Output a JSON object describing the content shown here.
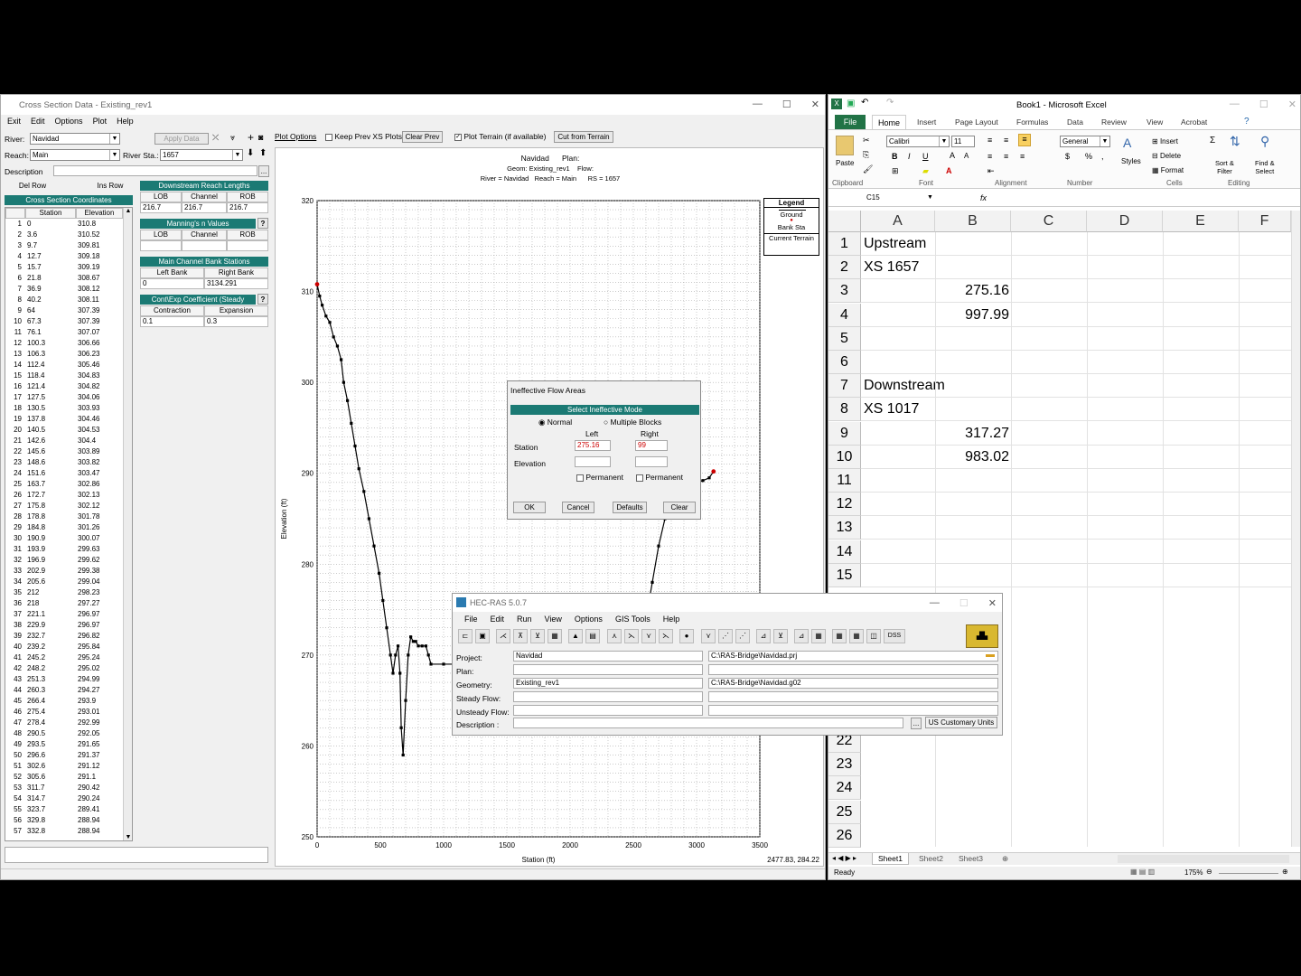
{
  "xs_window": {
    "title": "Cross Section Data - Existing_rev1",
    "menu": [
      "Exit",
      "Edit",
      "Options",
      "Plot",
      "Help"
    ],
    "river_label": "River:",
    "river_value": "Navidad",
    "reach_label": "Reach:",
    "reach_value": "Main",
    "river_sta_label": "River Sta.:",
    "river_sta_value": "1657",
    "apply_data": "Apply Data",
    "description_label": "Description",
    "del_row": "Del Row",
    "ins_row": "Ins Row",
    "plot_options": "Plot Options",
    "keep_prev": "Keep Prev XS Plots",
    "clear_prev": "Clear Prev",
    "plot_terrain": "Plot Terrain (if available)",
    "cut_terrain": "Cut from Terrain",
    "coords_title": "Cross Section Coordinates",
    "station_hdr": "Station",
    "elevation_hdr": "Elevation",
    "coords": [
      [
        "1",
        "0",
        "310.8"
      ],
      [
        "2",
        "3.6",
        "310.52"
      ],
      [
        "3",
        "9.7",
        "309.81"
      ],
      [
        "4",
        "12.7",
        "309.18"
      ],
      [
        "5",
        "15.7",
        "309.19"
      ],
      [
        "6",
        "21.8",
        "308.67"
      ],
      [
        "7",
        "36.9",
        "308.12"
      ],
      [
        "8",
        "40.2",
        "308.11"
      ],
      [
        "9",
        "64",
        "307.39"
      ],
      [
        "10",
        "67.3",
        "307.39"
      ],
      [
        "11",
        "76.1",
        "307.07"
      ],
      [
        "12",
        "100.3",
        "306.66"
      ],
      [
        "13",
        "106.3",
        "306.23"
      ],
      [
        "14",
        "112.4",
        "305.46"
      ],
      [
        "15",
        "118.4",
        "304.83"
      ],
      [
        "16",
        "121.4",
        "304.82"
      ],
      [
        "17",
        "127.5",
        "304.06"
      ],
      [
        "18",
        "130.5",
        "303.93"
      ],
      [
        "19",
        "137.8",
        "304.46"
      ],
      [
        "20",
        "140.5",
        "304.53"
      ],
      [
        "21",
        "142.6",
        "304.4"
      ],
      [
        "22",
        "145.6",
        "303.89"
      ],
      [
        "23",
        "148.6",
        "303.82"
      ],
      [
        "24",
        "151.6",
        "303.47"
      ],
      [
        "25",
        "163.7",
        "302.86"
      ],
      [
        "26",
        "172.7",
        "302.13"
      ],
      [
        "27",
        "175.8",
        "302.12"
      ],
      [
        "28",
        "178.8",
        "301.78"
      ],
      [
        "29",
        "184.8",
        "301.26"
      ],
      [
        "30",
        "190.9",
        "300.07"
      ],
      [
        "31",
        "193.9",
        "299.63"
      ],
      [
        "32",
        "196.9",
        "299.62"
      ],
      [
        "33",
        "202.9",
        "299.38"
      ],
      [
        "34",
        "205.6",
        "299.04"
      ],
      [
        "35",
        "212",
        "298.23"
      ],
      [
        "36",
        "218",
        "297.27"
      ],
      [
        "37",
        "221.1",
        "296.97"
      ],
      [
        "38",
        "229.9",
        "296.97"
      ],
      [
        "39",
        "232.7",
        "296.82"
      ],
      [
        "40",
        "239.2",
        "295.84"
      ],
      [
        "41",
        "245.2",
        "295.24"
      ],
      [
        "42",
        "248.2",
        "295.02"
      ],
      [
        "43",
        "251.3",
        "294.99"
      ],
      [
        "44",
        "260.3",
        "294.27"
      ],
      [
        "45",
        "266.4",
        "293.9"
      ],
      [
        "46",
        "275.4",
        "293.01"
      ],
      [
        "47",
        "278.4",
        "292.99"
      ],
      [
        "48",
        "290.5",
        "292.05"
      ],
      [
        "49",
        "293.5",
        "291.65"
      ],
      [
        "50",
        "296.6",
        "291.37"
      ],
      [
        "51",
        "302.6",
        "291.12"
      ],
      [
        "52",
        "305.6",
        "291.1"
      ],
      [
        "53",
        "311.7",
        "290.42"
      ],
      [
        "54",
        "314.7",
        "290.24"
      ],
      [
        "55",
        "323.7",
        "289.41"
      ],
      [
        "56",
        "329.8",
        "288.94"
      ],
      [
        "57",
        "332.8",
        "288.94"
      ]
    ],
    "reach_lengths_title": "Downstream Reach Lengths",
    "lob": "LOB",
    "channel": "Channel",
    "rob": "ROB",
    "reach_lengths": [
      "216.7",
      "216.7",
      "216.7"
    ],
    "mannings_title": "Manning's n Values",
    "bank_title": "Main Channel Bank Stations",
    "left_bank": "Left Bank",
    "right_bank": "Right Bank",
    "left_bank_val": "0",
    "right_bank_val": "3134.291",
    "contexp_title": "Cont\\Exp Coefficient (Steady",
    "contraction": "Contraction",
    "expansion": "Expansion",
    "contraction_val": "0.1",
    "expansion_val": "0.3",
    "plot_header_1": "Navidad      Plan:",
    "plot_header_2": "Geom: Existing_rev1    Flow:",
    "plot_header_3": "River = Navidad   Reach = Main      RS = 1657",
    "legend_title": "Legend",
    "legend_ground": "Ground",
    "legend_bank": "Bank Sta",
    "legend_terrain": "Current Terrain",
    "coord_readout": "2477.83, 284.22"
  },
  "chart_data": {
    "type": "line",
    "title": "",
    "xlabel": "Station (ft)",
    "ylabel": "Elevation (ft)",
    "xlim": [
      0,
      3500
    ],
    "ylim": [
      250,
      320
    ],
    "xticks": [
      0,
      500,
      1000,
      1500,
      2000,
      2500,
      3000,
      3500
    ],
    "yticks": [
      250,
      260,
      270,
      280,
      290,
      300,
      310,
      320
    ],
    "grid": true,
    "series": [
      {
        "name": "Ground",
        "color": "#000000",
        "x": [
          0,
          20,
          40,
          70,
          100,
          130,
          160,
          190,
          210,
          240,
          270,
          300,
          330,
          370,
          410,
          450,
          490,
          520,
          550,
          580,
          600,
          620,
          640,
          655,
          665,
          680,
          700,
          720,
          740,
          760,
          780,
          800,
          830,
          860,
          880,
          900,
          1000,
          1200,
          1500,
          1800,
          2000,
          2200,
          2500,
          2600,
          2650,
          2700,
          2750,
          2800,
          2850,
          2900,
          2950,
          3000,
          3050,
          3100,
          3134
        ],
        "y": [
          310.8,
          309.5,
          308.5,
          307.3,
          306.6,
          305,
          304,
          302.5,
          300,
          298,
          295.5,
          293,
          290.5,
          288,
          285,
          282,
          279,
          276,
          273,
          270,
          268,
          270,
          271,
          268,
          262,
          259,
          265,
          270,
          272,
          271.5,
          271.5,
          271,
          271,
          271,
          270,
          269,
          269,
          269,
          269,
          269,
          269,
          270,
          271,
          274,
          278,
          282,
          285,
          287,
          288,
          288.5,
          288.8,
          289,
          289.2,
          289.5,
          290.2
        ]
      },
      {
        "name": "Bank Sta",
        "color": "#cc0000",
        "x": [
          0,
          3134
        ],
        "y": [
          310.8,
          290.2
        ]
      }
    ]
  },
  "ineffective": {
    "title": "Ineffective Flow Areas",
    "mode_title": "Select Ineffective Mode",
    "normal": "Normal",
    "multiple": "Multiple Blocks",
    "left": "Left",
    "right": "Right",
    "station": "Station",
    "elevation": "Elevation",
    "station_left": "275.16",
    "station_right": "99",
    "permanent": "Permanent",
    "ok": "OK",
    "cancel": "Cancel",
    "defaults": "Defaults",
    "clear": "Clear"
  },
  "hecras": {
    "title": "HEC-RAS 5.0.7",
    "menu": [
      "File",
      "Edit",
      "Run",
      "View",
      "Options",
      "GIS Tools",
      "Help"
    ],
    "project_label": "Project:",
    "project": "Navidad",
    "project_path": "C:\\RAS-Bridge\\Navidad.prj",
    "plan_label": "Plan:",
    "geometry_label": "Geometry:",
    "geometry": "Existing_rev1",
    "geometry_path": "C:\\RAS-Bridge\\Navidad.g02",
    "steady_label": "Steady Flow:",
    "unsteady_label": "Unsteady Flow:",
    "desc_label": "Description :",
    "units": "US Customary Units",
    "dss": "DSS"
  },
  "excel": {
    "title": "Book1 - Microsoft Excel",
    "tabs": [
      "File",
      "Home",
      "Insert",
      "Page Layout",
      "Formulas",
      "Data",
      "Review",
      "View",
      "Acrobat"
    ],
    "font": "Calibri",
    "font_size": "11",
    "number_format": "General",
    "paste": "Paste",
    "styles": "Styles",
    "insert": "Insert",
    "delete": "Delete",
    "format": "Format",
    "sort": "Sort &\nFilter",
    "find": "Find &\nSelect",
    "groups": [
      "Clipboard",
      "Font",
      "Alignment",
      "Number",
      "Cells",
      "Editing"
    ],
    "name_box": "C15",
    "fx": "fx",
    "columns": [
      "A",
      "B",
      "C",
      "D",
      "E",
      "F"
    ],
    "rows": [
      {
        "n": "1",
        "a": "Upstream",
        "b": ""
      },
      {
        "n": "2",
        "a": "XS 1657",
        "b": ""
      },
      {
        "n": "3",
        "a": "",
        "b": "275.16"
      },
      {
        "n": "4",
        "a": "",
        "b": "997.99"
      },
      {
        "n": "5",
        "a": "",
        "b": ""
      },
      {
        "n": "6",
        "a": "",
        "b": ""
      },
      {
        "n": "7",
        "a": "Downstream",
        "b": ""
      },
      {
        "n": "8",
        "a": "XS 1017",
        "b": ""
      },
      {
        "n": "9",
        "a": "",
        "b": "317.27"
      },
      {
        "n": "10",
        "a": "",
        "b": "983.02"
      },
      {
        "n": "11",
        "a": "",
        "b": ""
      },
      {
        "n": "12",
        "a": "",
        "b": ""
      },
      {
        "n": "13",
        "a": "",
        "b": ""
      },
      {
        "n": "14",
        "a": "",
        "b": ""
      },
      {
        "n": "15",
        "a": "",
        "b": ""
      }
    ],
    "lower_rows": [
      "22",
      "23",
      "24",
      "25",
      "26"
    ],
    "sheets": [
      "Sheet1",
      "Sheet2",
      "Sheet3"
    ],
    "status": "Ready",
    "zoom": "175%"
  },
  "colors": {
    "teal": "#1b7a74",
    "excel_green": "#217346",
    "bank_red": "#cc0000"
  }
}
